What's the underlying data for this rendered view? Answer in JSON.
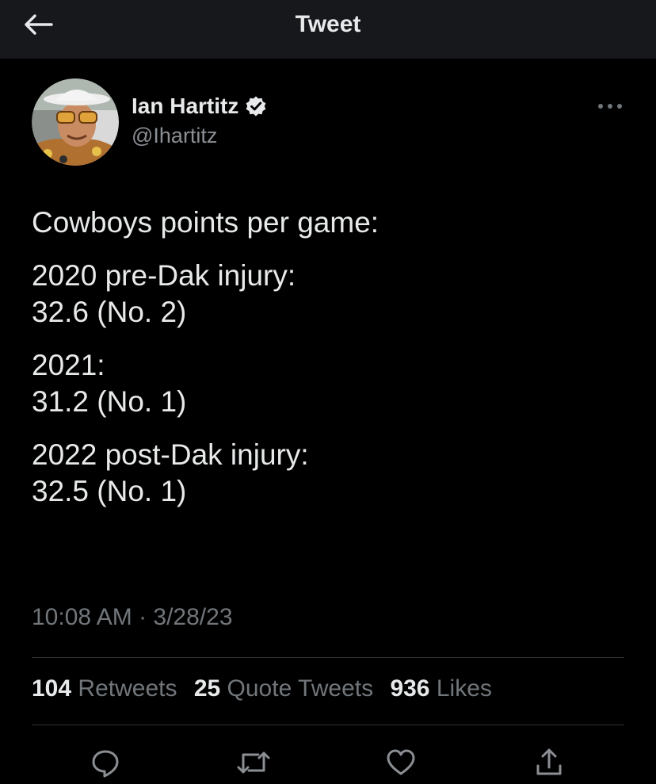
{
  "header": {
    "title": "Tweet",
    "back_icon": "arrow-left-icon"
  },
  "author": {
    "name": "Ian Hartitz",
    "handle": "@Ihartitz",
    "verified_icon": "verified-badge-icon",
    "more_icon": "more-horizontal-icon"
  },
  "tweet": {
    "lines": [
      "Cowboys points per game:",
      "2020 pre-Dak injury:",
      "32.6 (No. 2)",
      "2021:",
      "31.2 (No. 1)",
      "2022 post-Dak injury:",
      "32.5 (No. 1)"
    ],
    "timestamp": "10:08 AM · 3/28/23"
  },
  "stats": {
    "retweets_count": "104",
    "retweets_label": "Retweets",
    "quotes_count": "25",
    "quotes_label": "Quote Tweets",
    "likes_count": "936",
    "likes_label": "Likes"
  },
  "actions": {
    "reply_icon": "reply-icon",
    "retweet_icon": "retweet-icon",
    "like_icon": "heart-icon",
    "share_icon": "share-icon"
  },
  "colors": {
    "background": "#000000",
    "header_bg": "#16181c",
    "text": "#e7e9ea",
    "muted": "#71767b",
    "divider": "#2f3336"
  }
}
